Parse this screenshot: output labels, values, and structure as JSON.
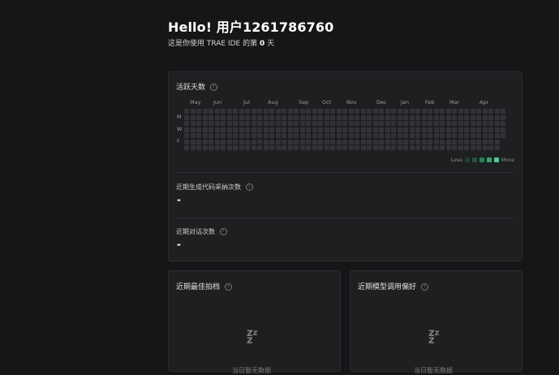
{
  "header": {
    "greeting": "Hello! 用户1261786760",
    "days_prefix": "这是你使用 TRAE IDE 的第",
    "days_count": "0",
    "days_suffix": "天"
  },
  "activity": {
    "title": "活跃天数",
    "months": [
      "May",
      "Jun",
      "Jul",
      "Aug",
      "Sep",
      "Oct",
      "Nov",
      "Dec",
      "Jan",
      "Feb",
      "Mar",
      "Apr"
    ],
    "day_labels": [
      "M",
      "W",
      "F"
    ],
    "legend_less": "Less",
    "legend_more": "More",
    "legend_colors": [
      "#2a3a33",
      "#22553f",
      "#2d7d57",
      "#35a86d",
      "#3fd38a"
    ],
    "cell_color": "#323336",
    "active_days": 0
  },
  "stats": [
    {
      "label": "近期生成代码采纳次数",
      "value": "-"
    },
    {
      "label": "近期对话次数",
      "value": "-"
    }
  ],
  "partner_card": {
    "title": "近期最佳拍档",
    "empty_icon": "zzz-sleep-icon",
    "empty_text": "当日暂无数据"
  },
  "model_card": {
    "title": "近期模型调用偏好",
    "empty_icon": "zzz-sleep-icon",
    "empty_text": "当日暂无数据"
  }
}
